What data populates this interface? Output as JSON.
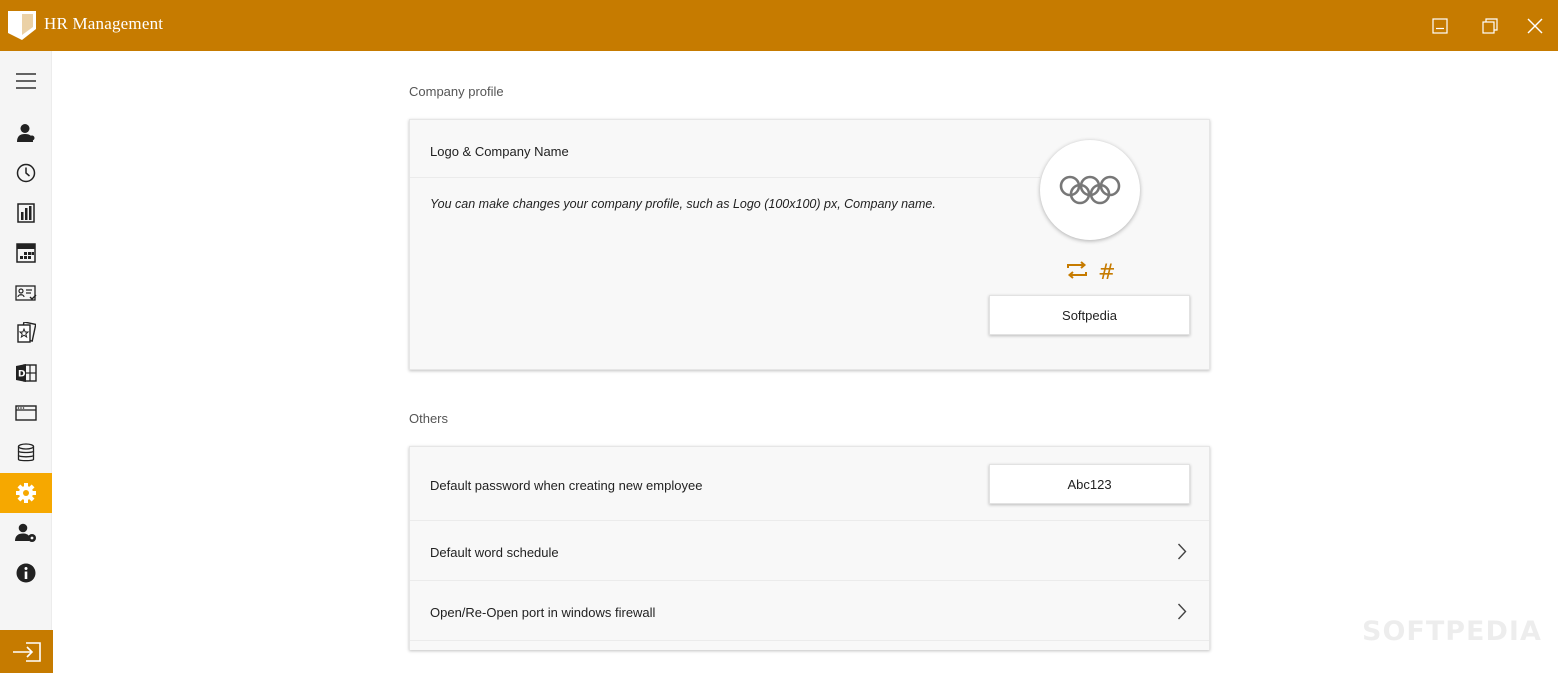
{
  "window": {
    "title": "HR Management",
    "accent_color": "#c67b00",
    "active_color": "#f6a800",
    "controls": [
      "minimize-icon",
      "restore-icon",
      "close-icon"
    ]
  },
  "sidebar": {
    "items": [
      {
        "name": "menu",
        "icon": "hamburger-menu-icon"
      },
      {
        "name": "employees",
        "icon": "person-icon"
      },
      {
        "name": "attendance",
        "icon": "clock-icon"
      },
      {
        "name": "reports",
        "icon": "bar-chart-icon"
      },
      {
        "name": "calendar",
        "icon": "calendar-grid-icon"
      },
      {
        "name": "id-card",
        "icon": "id-card-icon"
      },
      {
        "name": "rewards",
        "icon": "star-cards-icon"
      },
      {
        "name": "office-export",
        "icon": "office-doc-icon"
      },
      {
        "name": "window",
        "icon": "browser-window-icon"
      },
      {
        "name": "database",
        "icon": "database-icon"
      },
      {
        "name": "settings",
        "icon": "gear-icon",
        "active": true
      },
      {
        "name": "user-settings",
        "icon": "user-gear-icon"
      },
      {
        "name": "about",
        "icon": "info-icon"
      }
    ],
    "logout_icon": "sign-in-arrow-icon"
  },
  "company_profile": {
    "section_title": "Company profile",
    "card_title": "Logo & Company Name",
    "description": "You can make changes your company profile, such as Logo (100x100) px, Company name.",
    "logo_icon": "olympic-rings-logo",
    "change_logo_icon": "swap-icon",
    "hash_label": "#",
    "company_name": "Softpedia"
  },
  "others": {
    "section_title": "Others",
    "rows": [
      {
        "label": "Default password when creating new employee",
        "value": "Abc123"
      },
      {
        "label": "Default word schedule"
      },
      {
        "label": "Open/Re-Open port in windows firewall"
      }
    ]
  },
  "watermark": "SOFTPEDIA"
}
